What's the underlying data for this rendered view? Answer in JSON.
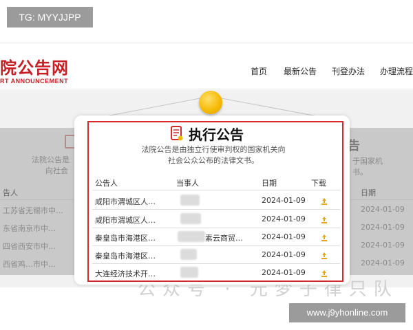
{
  "tag": {
    "text": "TG: MYYJJPP"
  },
  "header": {
    "logo_cn": "院公告网",
    "logo_en": "RT ANNOUNCEMENT",
    "nav": [
      "首页",
      "最新公告",
      "刊登办法",
      "办理流程"
    ]
  },
  "background": {
    "left_desc_1": "法院公告是",
    "left_desc_2": "向社会",
    "right_title": "告",
    "right_desc_1": "于国家机",
    "right_desc_2": "书。",
    "col_left": "告人",
    "col_right": "日期",
    "rows_left": [
      "工苏省无锡市中…",
      "东省南京市中…",
      "四省西安市中…",
      "西省鸡…市中…"
    ],
    "rows_right": [
      "2024-01-09",
      "2024-01-09",
      "2024-01-09",
      "2024-01-09"
    ],
    "bottom_text": "公众号 · 元梦子律只队"
  },
  "card": {
    "title": "执行公告",
    "subtitle_1": "法院公告是由独立行使审判权的国家机关向",
    "subtitle_2": "社会公众公布的法律文书。",
    "columns": [
      "公告人",
      "当事人",
      "日期",
      "下载"
    ],
    "rows": [
      {
        "announcer": "咸阳市渭城区人…",
        "party": "",
        "date": "2024-01-09"
      },
      {
        "announcer": "咸阳市渭城区人…",
        "party": "",
        "date": "2024-01-09"
      },
      {
        "announcer": "秦皇岛市海港区…",
        "party": "素云商贸…",
        "date": "2024-01-09"
      },
      {
        "announcer": "秦皇岛市海港区…",
        "party": "",
        "date": "2024-01-09"
      },
      {
        "announcer": "大连经济技术开…",
        "party": "",
        "date": "2024-01-09"
      }
    ]
  },
  "watermark": {
    "text": "www.j9yhonline.com"
  },
  "colors": {
    "brand_red": "#c71d23",
    "pin_yellow": "#f5b800",
    "download_icon": "#e8a317"
  }
}
